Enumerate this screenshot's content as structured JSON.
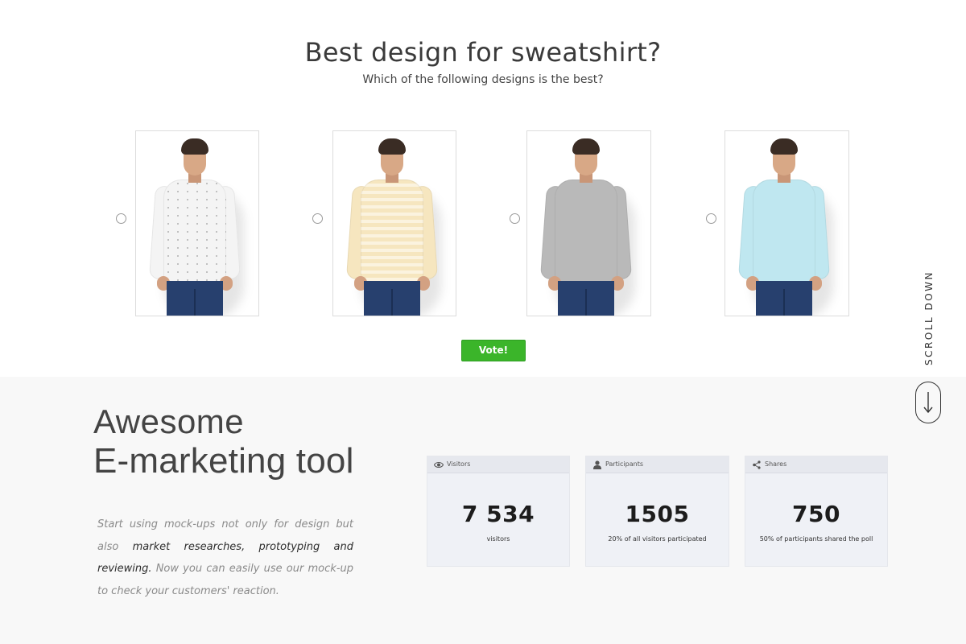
{
  "poll": {
    "title": "Best design for sweatshirt?",
    "subtitle": "Which of the following designs is the best?",
    "options": [
      {
        "design": "white patterned sweatshirt",
        "color": "#f4f4f4"
      },
      {
        "design": "cream striped sweatshirt",
        "color": "#f6e6bf"
      },
      {
        "design": "grey sweatshirt",
        "color": "#b9b9b9"
      },
      {
        "design": "light blue sweatshirt",
        "color": "#bfe7f0"
      }
    ],
    "vote_label": "Vote!"
  },
  "scroll": {
    "label": "SCROLL DOWN"
  },
  "promo": {
    "headline_line1": "Awesome",
    "headline_line2": "E-marketing tool",
    "description_part1": "Start using mock-ups not only for design but also ",
    "description_bold": "market researches, prototyping and reviewing.",
    "description_part2": " Now you can easily use our mock-up to check your customers' reaction."
  },
  "stats": [
    {
      "label": "Visitors",
      "icon": "eye-icon",
      "value": "7 534",
      "caption": "visitors"
    },
    {
      "label": "Participants",
      "icon": "user-icon",
      "value": "1505",
      "caption": "20% of all visitors participated"
    },
    {
      "label": "Shares",
      "icon": "share-icon",
      "value": "750",
      "caption": "50% of participants shared the poll"
    }
  ],
  "colors": {
    "accent": "#3bb52a",
    "stat_card": "#eff1f6",
    "section_bg": "#f8f8f8"
  }
}
